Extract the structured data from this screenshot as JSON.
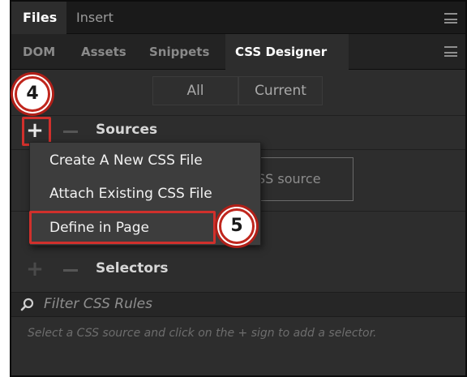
{
  "panel_tabs": [
    "Files",
    "Insert"
  ],
  "sub_tabs": [
    "DOM",
    "Assets",
    "Snippets",
    "CSS Designer"
  ],
  "toggle": {
    "all": "All",
    "current": "Current"
  },
  "sections": {
    "sources": {
      "add_symbol": "+",
      "title": "Sources"
    },
    "selectors": {
      "add_symbol": "+",
      "title": "Selectors"
    }
  },
  "dropdown": {
    "items": [
      "Create A New CSS File",
      "Attach Existing CSS File",
      "Define in Page"
    ],
    "highlighted_item": "Define in Page"
  },
  "ghost_button": {
    "label": "SS source"
  },
  "filter": {
    "placeholder": "Filter CSS Rules"
  },
  "hint_text": "Select a CSS source and click on the + sign to add a selector.",
  "callouts": {
    "step_add": "4",
    "step_define": "5"
  },
  "icons": {
    "panel_menu": "hamburger-menu-icon",
    "search": "search-icon"
  },
  "colors": {
    "panel_bg": "#2d2d2d",
    "highlight_red": "#d0302c",
    "active_tab_bg": "#2d2d2d"
  }
}
